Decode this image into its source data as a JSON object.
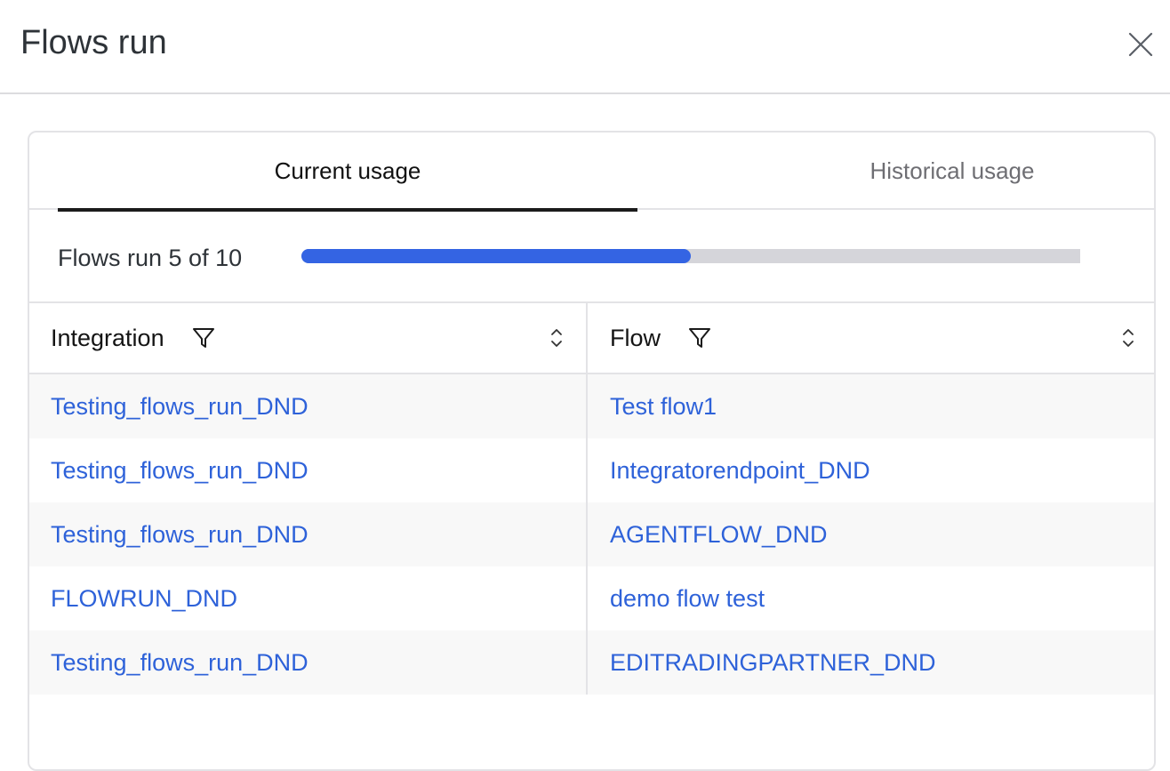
{
  "dialog": {
    "title": "Flows run",
    "close_icon": "close-icon"
  },
  "tabs": [
    {
      "label": "Current usage",
      "active": true
    },
    {
      "label": "Historical usage",
      "active": false
    }
  ],
  "usage": {
    "label": "Flows run 5 of 10",
    "used": 5,
    "total": 10,
    "fill_color": "#3464e3",
    "track_color": "#d5d5da"
  },
  "table": {
    "columns": [
      {
        "label": "Integration",
        "filter_icon": "filter-icon",
        "sort_icon": "sort-icon"
      },
      {
        "label": "Flow",
        "filter_icon": "filter-icon",
        "sort_icon": "sort-icon"
      }
    ],
    "rows": [
      {
        "integration": "Testing_flows_run_DND",
        "flow": "Test flow1"
      },
      {
        "integration": "Testing_flows_run_DND",
        "flow": "Integratorendpoint_DND"
      },
      {
        "integration": "Testing_flows_run_DND",
        "flow": "AGENTFLOW_DND"
      },
      {
        "integration": "FLOWRUN_DND",
        "flow": "demo flow test"
      },
      {
        "integration": "Testing_flows_run_DND",
        "flow": "EDITRADINGPARTNER_DND"
      }
    ],
    "link_color": "#2e62d9"
  }
}
